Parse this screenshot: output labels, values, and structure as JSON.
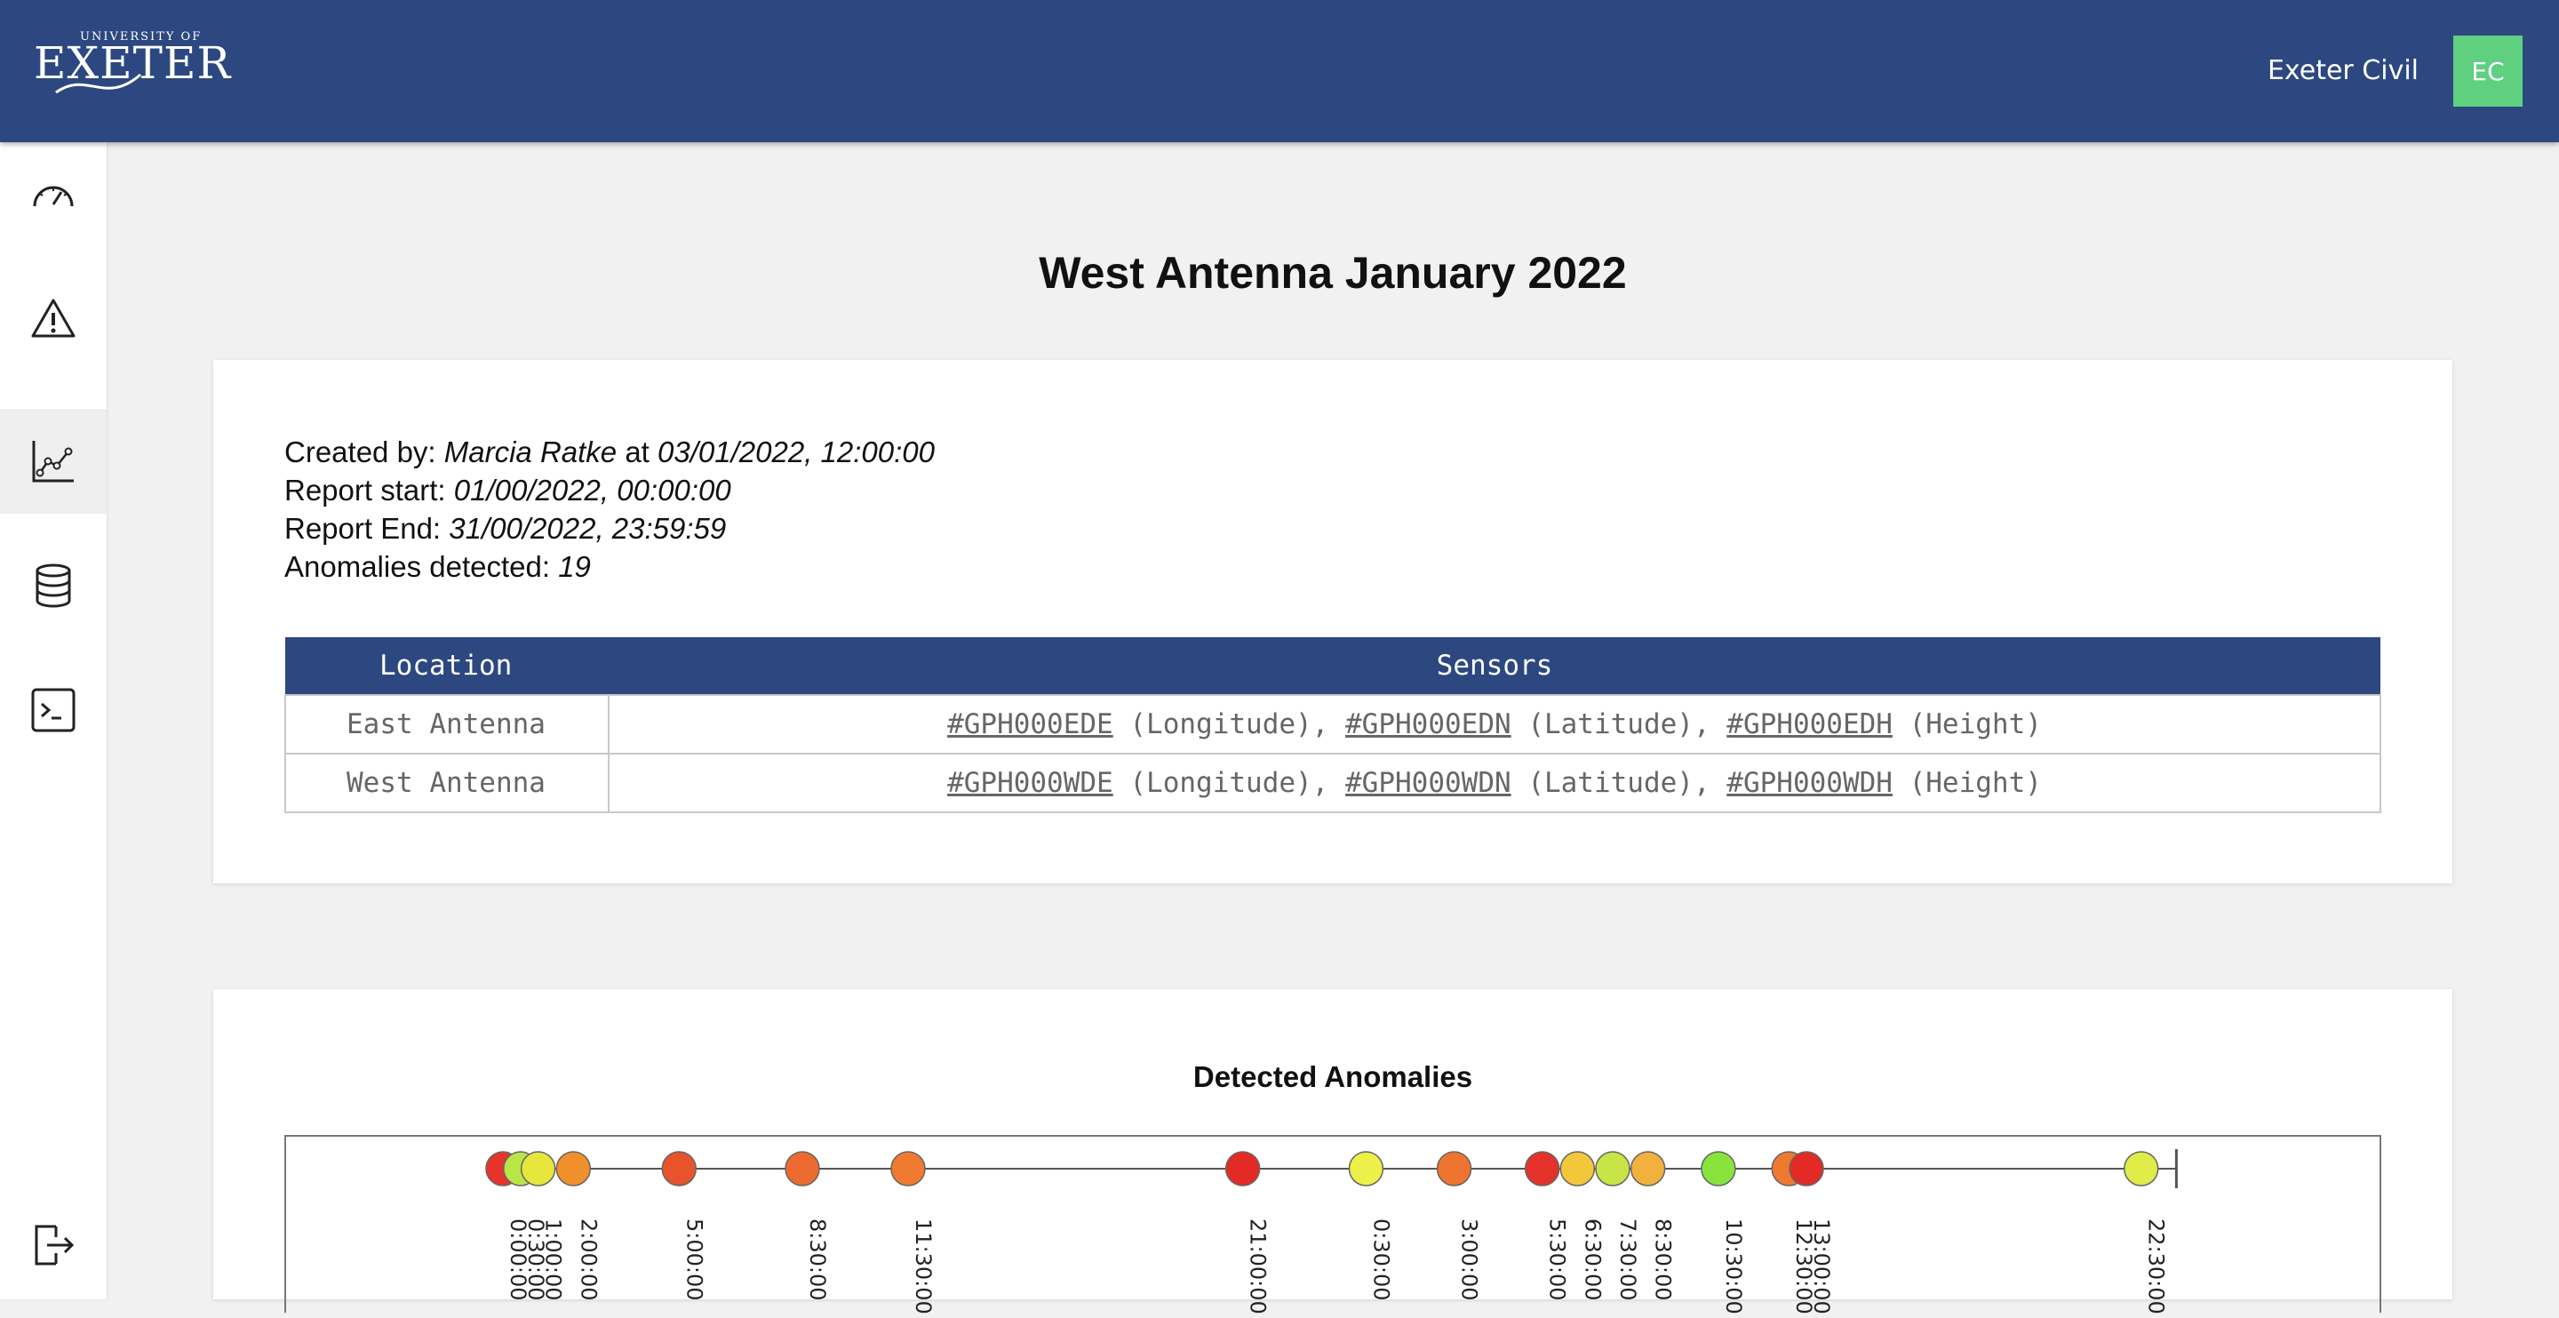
{
  "header": {
    "logo_top": "UNIVERSITY OF",
    "logo_main": "EXETER",
    "org_name": "Exeter Civil",
    "avatar_initials": "EC",
    "bar_color": "#2d4880",
    "avatar_color": "#5fcf80"
  },
  "sidebar": {
    "items": [
      {
        "icon": "speedometer-icon",
        "active": false
      },
      {
        "icon": "warning-icon",
        "active": false
      },
      {
        "icon": "chart-line-icon",
        "active": true
      },
      {
        "icon": "database-icon",
        "active": false
      },
      {
        "icon": "terminal-icon",
        "active": false
      }
    ],
    "logout_icon": "logout-icon"
  },
  "page": {
    "title": "West Antenna January 2022"
  },
  "report": {
    "created_label": "Created by: ",
    "created_by": "Marcia Ratke",
    "created_at_label": " at ",
    "created_at": "03/01/2022, 12:00:00",
    "start_label": "Report start: ",
    "start": "01/00/2022, 00:00:00",
    "end_label": "Report End: ",
    "end": "31/00/2022, 23:59:59",
    "anomalies_label": "Anomalies detected: ",
    "anomalies": "19"
  },
  "sensor_table": {
    "headers": [
      "Location",
      "Sensors"
    ],
    "rows": [
      {
        "location": "East Antenna",
        "sensors": [
          {
            "id": "#GPH000EDE",
            "type": " (Longitude), "
          },
          {
            "id": "#GPH000EDN",
            "type": " (Latitude), "
          },
          {
            "id": "#GPH000EDH",
            "type": " (Height)"
          }
        ]
      },
      {
        "location": "West Antenna",
        "sensors": [
          {
            "id": "#GPH000WDE",
            "type": " (Longitude), "
          },
          {
            "id": "#GPH000WDN",
            "type": " (Latitude), "
          },
          {
            "id": "#GPH000WDH",
            "type": " (Height)"
          }
        ]
      }
    ]
  },
  "chart_data": {
    "type": "scatter",
    "title": "Detected Anomalies",
    "x_unit": "time of day (hours)",
    "xlim": [
      0,
      24
    ],
    "points": [
      {
        "t": 0.0,
        "label": "0:00:00",
        "color": "#e8332a"
      },
      {
        "t": 0.5,
        "label": "0:30:00",
        "color": "#b9e646"
      },
      {
        "t": 1.0,
        "label": "1:00:00",
        "color": "#e6e63c"
      },
      {
        "t": 2.0,
        "label": "2:00:00",
        "color": "#f0902c"
      },
      {
        "t": 5.0,
        "label": "5:00:00",
        "color": "#e8532c"
      },
      {
        "t": 8.5,
        "label": "8:30:00",
        "color": "#ec6a30"
      },
      {
        "t": 11.5,
        "label": "11:30:00",
        "color": "#ef7a30"
      },
      {
        "t": 21.0,
        "label": "21:00:00",
        "color": "#e42a24"
      },
      {
        "t": 24.5,
        "label": "0:30:00",
        "color": "#ecf048"
      },
      {
        "t": 27.0,
        "label": "3:00:00",
        "color": "#ee7430"
      },
      {
        "t": 29.5,
        "label": "5:30:00",
        "color": "#e4322a"
      },
      {
        "t": 30.5,
        "label": "6:30:00",
        "color": "#f2c83a"
      },
      {
        "t": 31.5,
        "label": "7:30:00",
        "color": "#c8e446"
      },
      {
        "t": 32.5,
        "label": "8:30:00",
        "color": "#f2b03c"
      },
      {
        "t": 34.5,
        "label": "10:30:00",
        "color": "#88e43c"
      },
      {
        "t": 36.5,
        "label": "12:30:00",
        "color": "#ee7a30"
      },
      {
        "t": 37.0,
        "label": "13:00:00",
        "color": "#e42a24"
      },
      {
        "t": 46.5,
        "label": "22:30:00",
        "color": "#e0ec48"
      }
    ],
    "axis_end": 47.5
  }
}
